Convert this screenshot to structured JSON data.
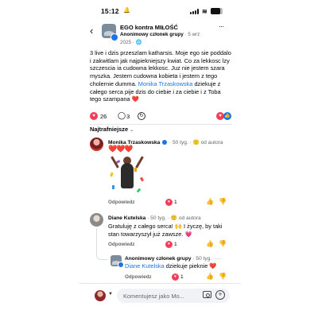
{
  "status_bar": {
    "time": "15:12",
    "bell": "🔔",
    "wifi": "≋",
    "battery_level": 0.8
  },
  "header": {
    "back_icon": "‹",
    "group_name": "EGO kontra MIŁOŚĆ",
    "author": "Anonimowy członek grupy",
    "date_part1": "· 5 wrz",
    "date_part2": "2025 · 🌐",
    "more_icon": "···"
  },
  "post": {
    "text_before": "3 live i dzis przeszlam katharsis. Moje ego sie poddalo i zakwitlam jak najpiekniejszy kwiat. Co za lekkosc lzy szczescia ia cudowna lekkosc. Juz nie jestem szara myszka. Jestem cudowna kobieta i jestem z tego cholernie dumma. ",
    "mention": "Monika Trzaskowska",
    "text_after": " dziekuje z całego serca pije dzis do ciebie i za ciebie i z Toba tego szampana ❤️",
    "reaction_count": "26",
    "comment_count": "3",
    "comment_icon": "◯",
    "share_icon": "↻"
  },
  "sort": {
    "label": "Najtrafniejsze",
    "chevron": "⌄"
  },
  "comments": [
    {
      "name": "Monika Trzaskowska",
      "meta": "· 50 tyg. · 🙂 od autora",
      "text": "❤️❤️❤️",
      "reply_label": "Odpowiedz",
      "reaction_count": "1"
    },
    {
      "name": "Diane Kutelska",
      "meta": "· 50 tyg. · 🙂 od autora",
      "text": "Gratuluję z całego serca! 🙌 I życzę, by taki stan towarzyszył już zawsze. 💗",
      "reply_label": "Odpowiedz",
      "reaction_count": "1"
    },
    {
      "name": "Anonimowy członek grupy",
      "meta": "· 50 tyg.",
      "mention": "Diane Kutelska",
      "text_after": " dziekuje pieknie ❤️",
      "reply_label": "Odpowiedz",
      "reaction_count": "1"
    }
  ],
  "composer": {
    "placeholder": "Komentujesz jako Mo...",
    "caret": "▼"
  },
  "colors": {
    "accent": "#1b74e4",
    "heart": "#f33e58"
  }
}
